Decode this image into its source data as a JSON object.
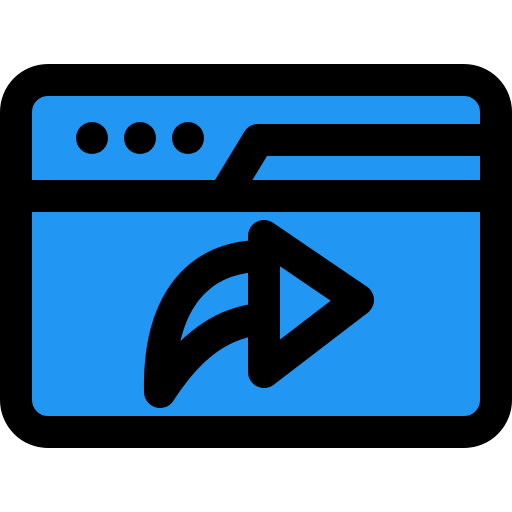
{
  "icon": {
    "name": "browser-window-share-icon",
    "colors": {
      "fill": "#2196F3",
      "stroke": "#000000",
      "background": "#FFFFFF"
    },
    "elements": {
      "window": "browser-window",
      "dots": [
        "window-dot",
        "window-dot",
        "window-dot"
      ],
      "tab": "browser-tab",
      "arrow": "share-arrow"
    }
  }
}
